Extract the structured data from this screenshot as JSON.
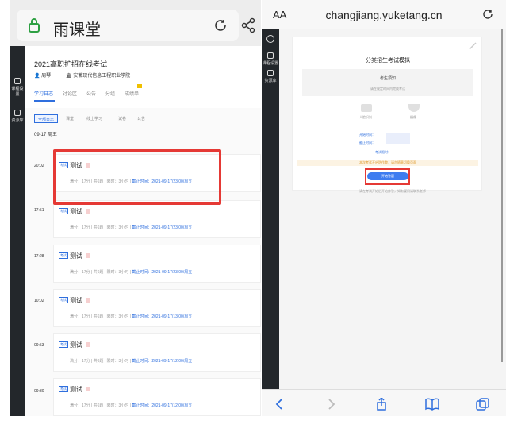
{
  "left": {
    "browser_title": "雨课堂",
    "course": {
      "title": "2021高职扩招在线考试",
      "teacher": "周琴",
      "school": "安徽现代信息工程职业学院"
    },
    "tabs": [
      "学习日志",
      "讨论区",
      "公告",
      "分组",
      "成绩单"
    ],
    "filters": [
      "全部日志",
      "课堂",
      "线上学习",
      "试卷",
      "公告"
    ],
    "date_header": "09-17 周五",
    "rows": [
      {
        "time": "20:02",
        "tag": "考试",
        "name": "测试",
        "meta": "满分：17分  |  共6题  |  限时：3小时  |  ",
        "deadline": "截止时间：2021-09-17/23:00/周五"
      },
      {
        "time": "17:51",
        "tag": "考试",
        "name": "测试",
        "meta": "满分：17分  |  共6题  |  限时：3小时  |  ",
        "deadline": "截止时间：2021-09-17/23:00/周五"
      },
      {
        "time": "17:28",
        "tag": "考试",
        "name": "测试",
        "meta": "满分：17分  |  共6题  |  限时：3小时  |  ",
        "deadline": "截止时间：2021-09-17/23:00/周五"
      },
      {
        "time": "10:02",
        "tag": "考试",
        "name": "测试",
        "meta": "满分：17分  |  共6题  |  限时：3小时  |  ",
        "deadline": "截止时间：2021-09-17/13:00/周五"
      },
      {
        "time": "09:53",
        "tag": "考试",
        "name": "测试",
        "meta": "满分：17分  |  共6题  |  限时：3小时  |  ",
        "deadline": "截止时间：2021-09-17/12:00/周五"
      },
      {
        "time": "09:30",
        "tag": "考试",
        "name": "测试",
        "meta": "满分：17分  |  共6题  |  限时：3小时  |  ",
        "deadline": "截止时间：2021-09-17/12:00/周五"
      }
    ],
    "sidebar": [
      "课程设置",
      "资源库"
    ]
  },
  "right": {
    "aa": "AA",
    "domain": "changjiang.yuketang.cn",
    "exam_title": "分类招生考试模拟",
    "info_title": "考生须知",
    "info_sub": "请在规定时间内完成考试",
    "gicon_labels": [
      "人脸识别",
      "摄像"
    ],
    "info_labels": [
      "开始时间：",
      "截止时间：",
      "考试限时："
    ],
    "warning": "本次考试开启防作弊，请勿随意切换页面",
    "start_button": "开始答题",
    "below_text": "请在考试开始后开始作答，如有疑问请联系老师"
  }
}
